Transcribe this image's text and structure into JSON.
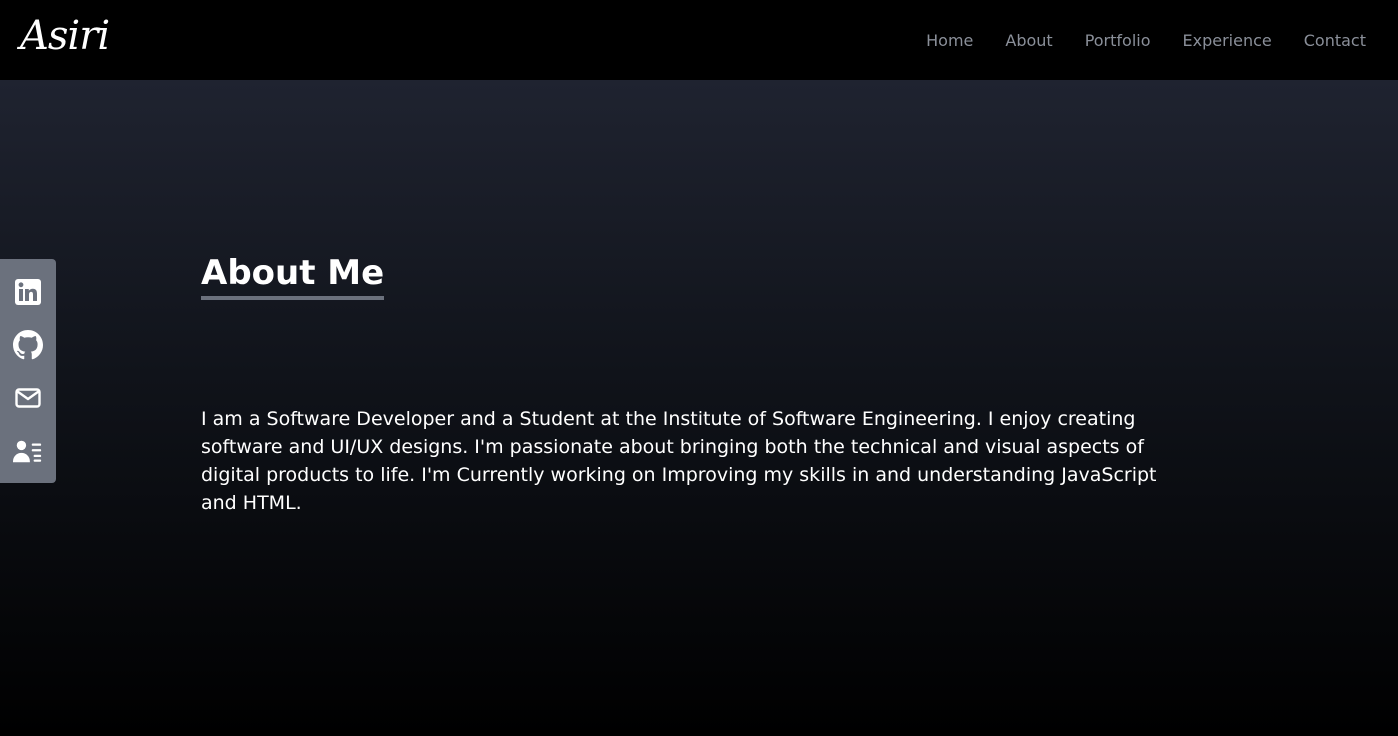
{
  "header": {
    "logo_text": "Asiri",
    "nav": [
      "Home",
      "About",
      "Portfolio",
      "Experience",
      "Contact"
    ]
  },
  "about": {
    "title": "About Me",
    "body": "I am a Software Developer and a Student at the Institute of Software Engineering. I enjoy creating software and UI/UX designs. I'm passionate about bringing both the technical and visual aspects of digital products to life. I'm Currently working on Improving my skills in and understanding JavaScript and HTML."
  },
  "social": {
    "icons": [
      "linkedin-icon",
      "github-icon",
      "mail-icon",
      "resume-icon"
    ]
  },
  "colors": {
    "nav_text": "#8a8f99",
    "social_bar": "#6b717d",
    "title_underline": "#6b717d"
  }
}
